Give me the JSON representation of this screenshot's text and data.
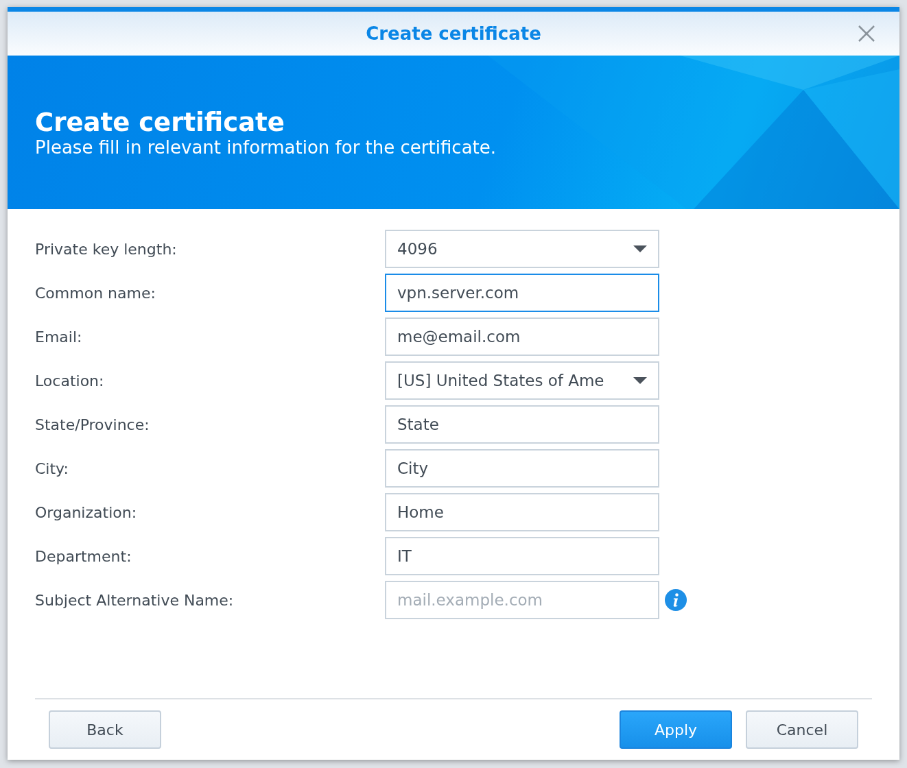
{
  "window": {
    "title": "Create certificate"
  },
  "banner": {
    "heading": "Create certificate",
    "subtitle": "Please fill in relevant information for the certificate."
  },
  "fields": [
    {
      "label": "Private key length:",
      "kind": "select",
      "value": "4096",
      "focused": false
    },
    {
      "label": "Common name:",
      "kind": "text",
      "value": "vpn.server.com",
      "focused": true
    },
    {
      "label": "Email:",
      "kind": "text",
      "value": "me@email.com",
      "focused": false
    },
    {
      "label": "Location:",
      "kind": "select",
      "value": "[US] United States of Ame",
      "focused": false
    },
    {
      "label": "State/Province:",
      "kind": "text",
      "value": "State",
      "focused": false
    },
    {
      "label": "City:",
      "kind": "text",
      "value": "City",
      "focused": false
    },
    {
      "label": "Organization:",
      "kind": "text",
      "value": "Home",
      "focused": false
    },
    {
      "label": "Department:",
      "kind": "text",
      "value": "IT",
      "focused": false
    },
    {
      "label": "Subject Alternative Name:",
      "kind": "text",
      "placeholder": "mail.example.com",
      "focused": false,
      "info": true
    }
  ],
  "buttons_left": [
    {
      "label": "Back",
      "primary": false
    }
  ],
  "buttons_right": [
    {
      "label": "Apply",
      "primary": true
    },
    {
      "label": "Cancel",
      "primary": false
    }
  ]
}
